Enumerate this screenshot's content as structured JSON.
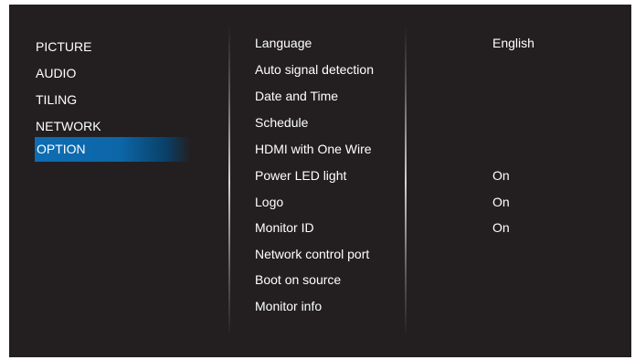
{
  "left_menu": {
    "items": [
      {
        "label": "PICTURE"
      },
      {
        "label": "AUDIO"
      },
      {
        "label": "TILING"
      },
      {
        "label": "NETWORK"
      },
      {
        "label": "OPTION",
        "selected": true
      }
    ]
  },
  "option_menu": {
    "items": [
      {
        "label": "Language",
        "value": "English"
      },
      {
        "label": "Auto signal detection",
        "value": ""
      },
      {
        "label": "Date and Time",
        "value": ""
      },
      {
        "label": "Schedule",
        "value": ""
      },
      {
        "label": "HDMI with One Wire",
        "value": ""
      },
      {
        "label": "Power LED light",
        "value": "On"
      },
      {
        "label": "Logo",
        "value": "On"
      },
      {
        "label": "Monitor ID",
        "value": "On"
      },
      {
        "label": "Network control port",
        "value": ""
      },
      {
        "label": "Boot on source",
        "value": ""
      },
      {
        "label": "Monitor info",
        "value": ""
      }
    ]
  },
  "colors": {
    "background": "#231f20",
    "highlight": "#0e6db3",
    "text": "#ffffff"
  }
}
